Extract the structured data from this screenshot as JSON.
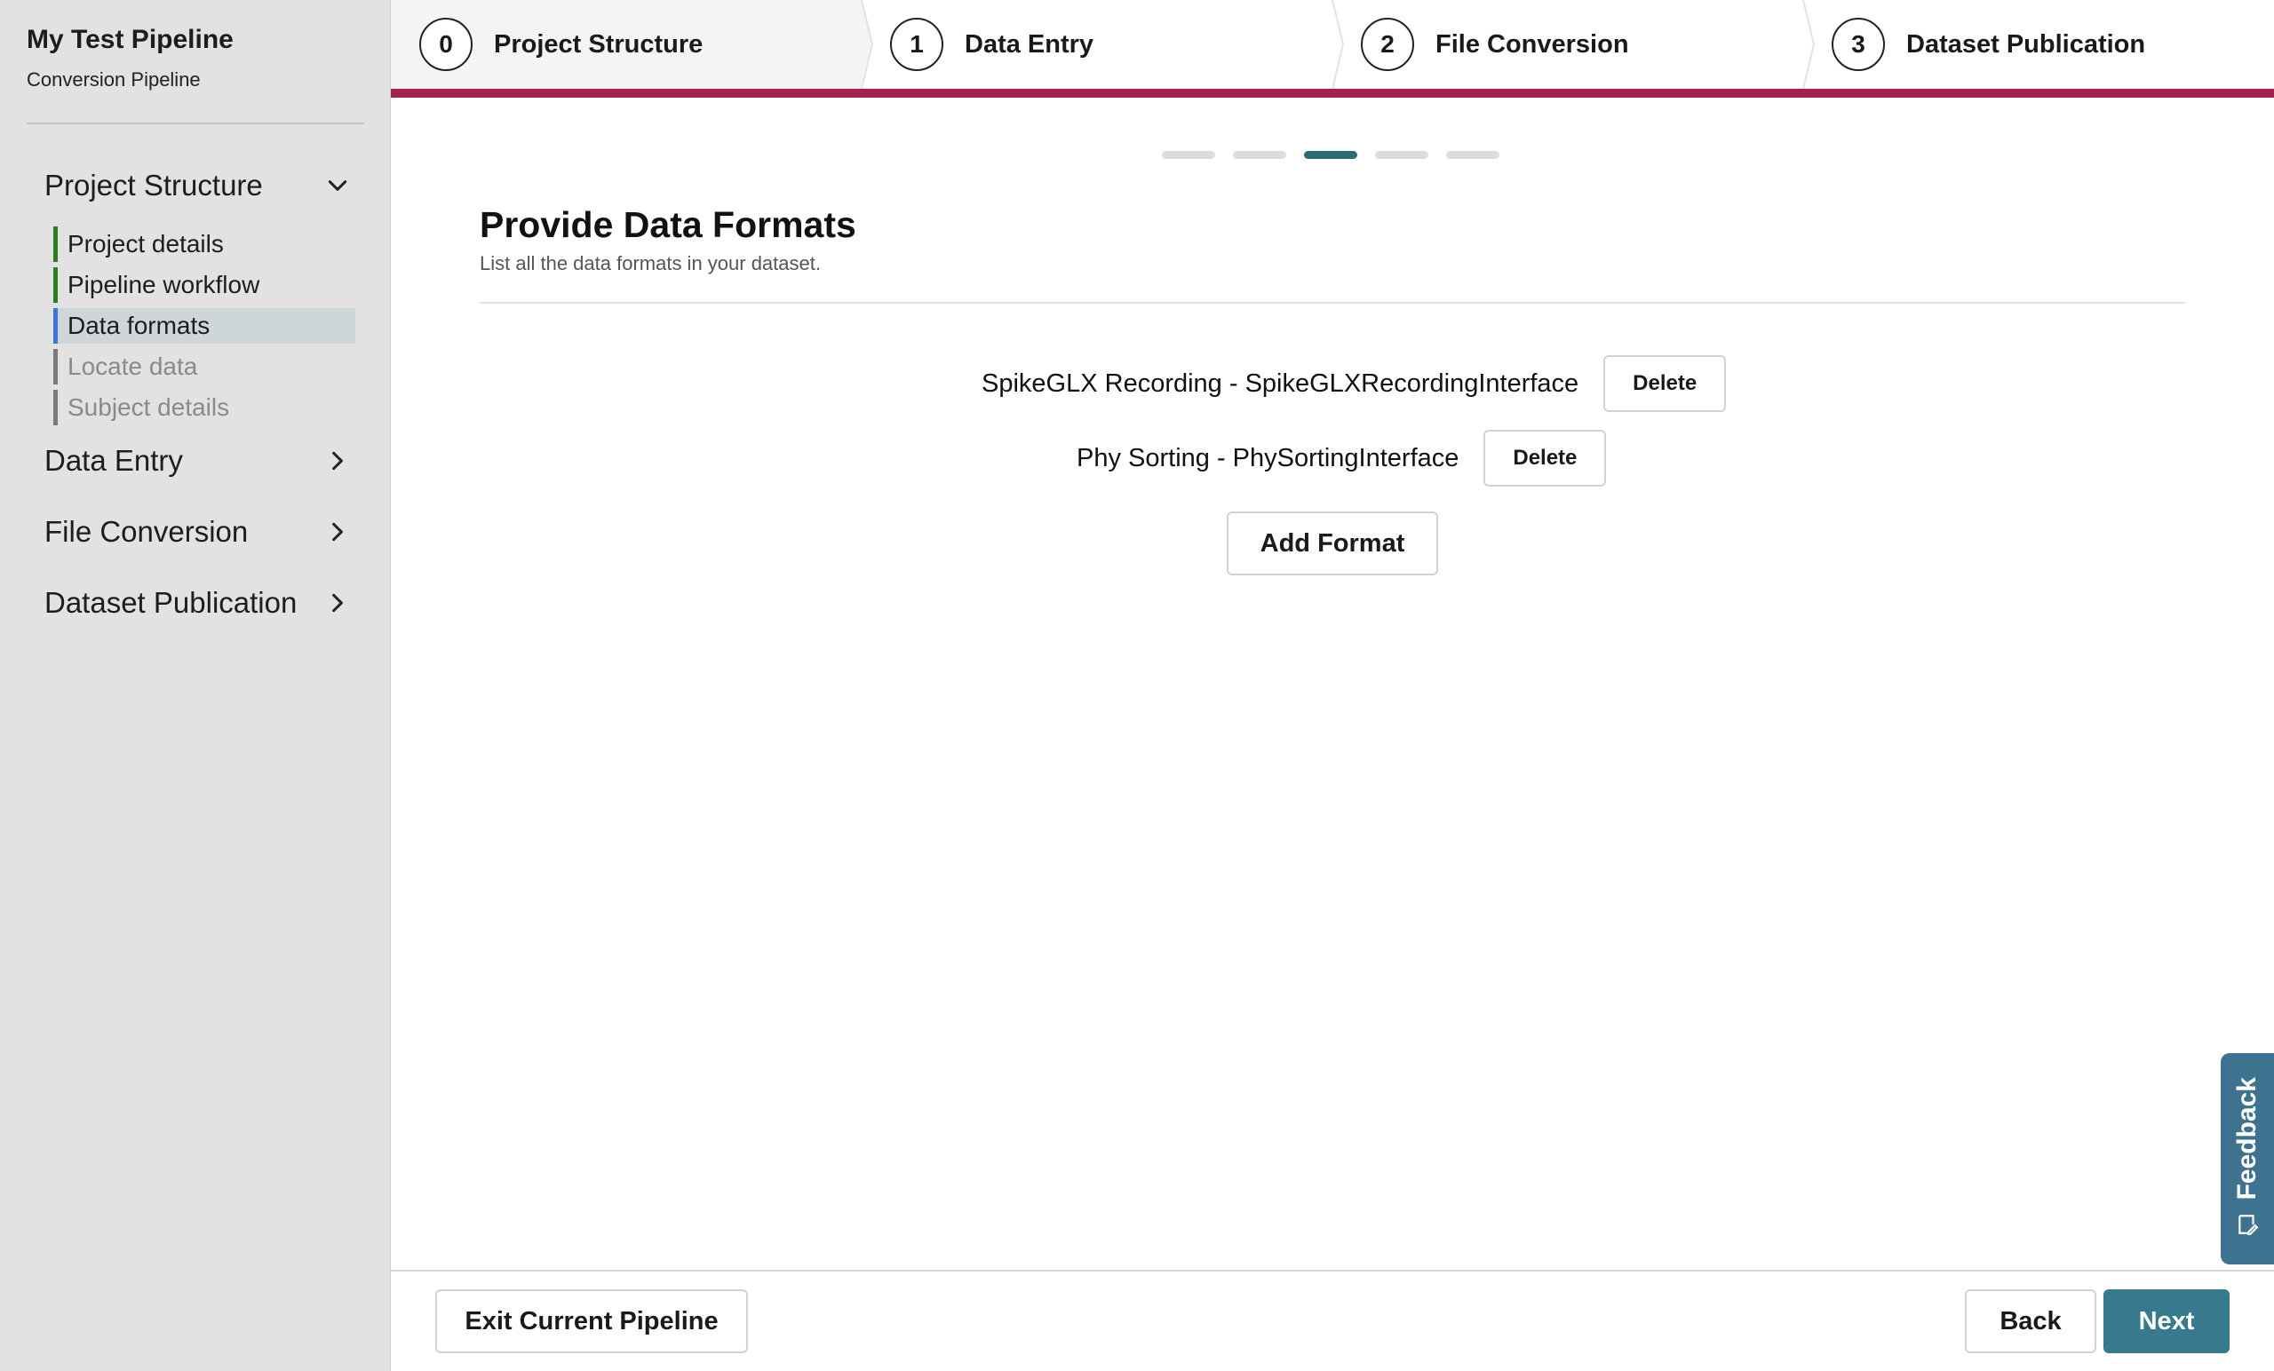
{
  "sidebar": {
    "title": "My Test Pipeline",
    "subtitle": "Conversion Pipeline",
    "sections": [
      {
        "label": "Project Structure",
        "expanded": true,
        "items": [
          {
            "label": "Project details",
            "state": "done"
          },
          {
            "label": "Pipeline workflow",
            "state": "done"
          },
          {
            "label": "Data formats",
            "state": "active"
          },
          {
            "label": "Locate data",
            "state": "pending"
          },
          {
            "label": "Subject details",
            "state": "pending"
          }
        ]
      },
      {
        "label": "Data Entry",
        "expanded": false
      },
      {
        "label": "File Conversion",
        "expanded": false
      },
      {
        "label": "Dataset Publication",
        "expanded": false
      }
    ]
  },
  "stepper": {
    "steps": [
      {
        "number": "0",
        "label": "Project Structure"
      },
      {
        "number": "1",
        "label": "Data Entry"
      },
      {
        "number": "2",
        "label": "File Conversion"
      },
      {
        "number": "3",
        "label": "Dataset Publication"
      }
    ],
    "accent_color": "#a4214a"
  },
  "page_dots": {
    "total": 5,
    "active": 2
  },
  "main": {
    "title": "Provide Data Formats",
    "description": "List all the data formats in your dataset.",
    "formats": [
      {
        "label": "SpikeGLX Recording - SpikeGLXRecordingInterface",
        "delete_label": "Delete"
      },
      {
        "label": "Phy Sorting - PhySortingInterface",
        "delete_label": "Delete"
      }
    ],
    "add_label": "Add Format"
  },
  "feedback": {
    "label": "Feedback",
    "icon": "feedback-icon"
  },
  "footer": {
    "exit_label": "Exit Current Pipeline",
    "back_label": "Back",
    "next_label": "Next",
    "next_color": "#387a8d"
  }
}
